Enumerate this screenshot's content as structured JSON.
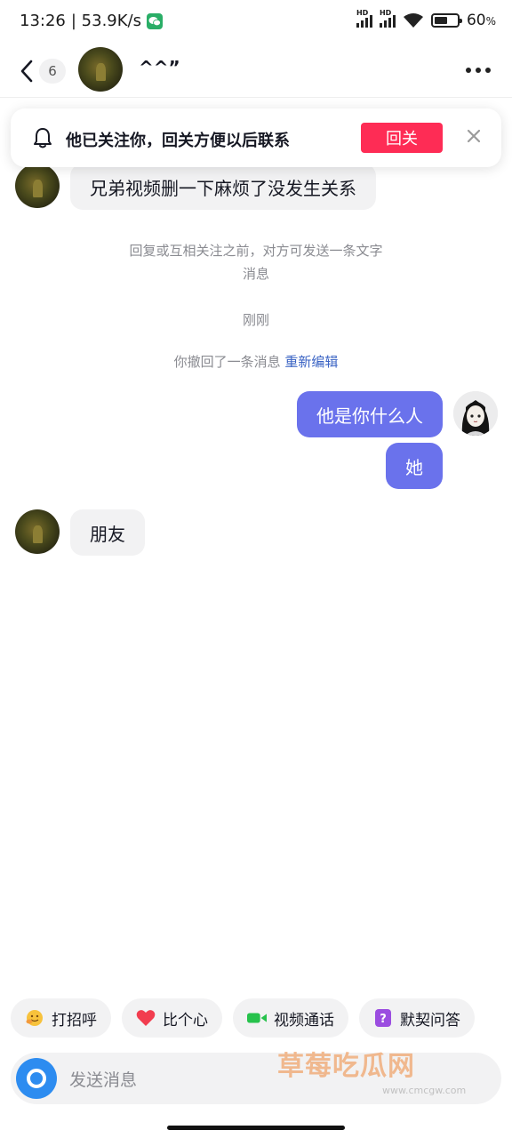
{
  "status_bar": {
    "time": "13:26",
    "net_speed": "| 53.9K/s",
    "battery": "60",
    "battery_unit": "%",
    "battery_level": 0.6,
    "hd_label": "HD"
  },
  "header": {
    "unread_count": "6",
    "contact_name": "^^”"
  },
  "follow_banner": {
    "text": "他已关注你，回关方便以后联系",
    "button_label": "回关",
    "accent_color": "#fe2c55"
  },
  "messages": {
    "m1": "兄弟视频删一下麻烦了没发生关系",
    "notice_line1": "回复或互相关注之前，对方可发送一条文字",
    "notice_line2": "消息",
    "timestamp": "刚刚",
    "recall_text": "你撤回了一条消息",
    "recall_link": "重新编辑",
    "m2": "他是你什么人",
    "m3": "她",
    "m4": "朋友",
    "outgoing_color": "#6a72ec"
  },
  "quick_replies": [
    {
      "label": "打招呼",
      "icon": "wave-emoji-icon"
    },
    {
      "label": "比个心",
      "icon": "heart-icon"
    },
    {
      "label": "视频通话",
      "icon": "video-camera-icon"
    },
    {
      "label": "默契问答",
      "icon": "question-card-icon"
    }
  ],
  "input": {
    "placeholder": "发送消息"
  },
  "watermark": {
    "text": "草莓吃瓜网",
    "url": "www.cmcgw.com"
  }
}
